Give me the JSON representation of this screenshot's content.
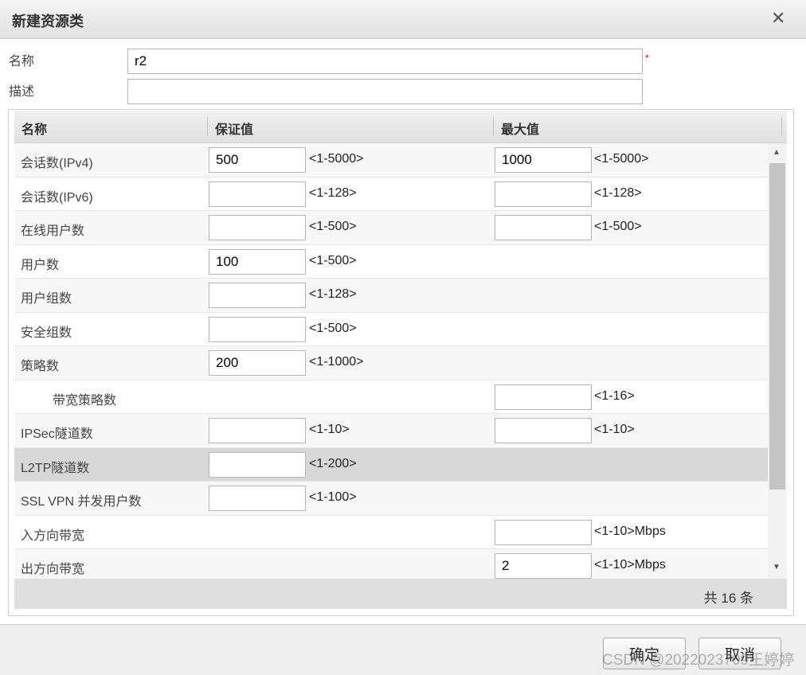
{
  "dialog": {
    "title": "新建资源类"
  },
  "form": {
    "name_label": "名称",
    "name_value": "r2",
    "required_mark": "*",
    "desc_label": "描述",
    "desc_value": ""
  },
  "grid": {
    "columns": [
      "名称",
      "保证值",
      "最大值"
    ],
    "rows": [
      {
        "name": "会话数(IPv4)",
        "guarantee": "500",
        "guarantee_hint": "<1-5000>",
        "max": "1000",
        "max_hint": "<1-5000>"
      },
      {
        "name": "会话数(IPv6)",
        "guarantee": "",
        "guarantee_hint": "<1-128>",
        "max": "",
        "max_hint": "<1-128>"
      },
      {
        "name": "在线用户数",
        "guarantee": "",
        "guarantee_hint": "<1-500>",
        "max": "",
        "max_hint": "<1-500>"
      },
      {
        "name": "用户数",
        "guarantee": "100",
        "guarantee_hint": "<1-500>"
      },
      {
        "name": "用户组数",
        "guarantee": "",
        "guarantee_hint": "<1-128>"
      },
      {
        "name": "安全组数",
        "guarantee": "",
        "guarantee_hint": "<1-500>"
      },
      {
        "name": "策略数",
        "guarantee": "200",
        "guarantee_hint": "<1-1000>"
      },
      {
        "name": "带宽策略数",
        "indent": true,
        "max": "",
        "max_hint": "<1-16>"
      },
      {
        "name": "IPSec隧道数",
        "guarantee": "",
        "guarantee_hint": "<1-10>",
        "max": "",
        "max_hint": "<1-10>"
      },
      {
        "name": "L2TP隧道数",
        "selected": true,
        "guarantee": "",
        "guarantee_hint": "<1-200>"
      },
      {
        "name": "SSL VPN 并发用户数",
        "guarantee": "",
        "guarantee_hint": "<1-100>"
      },
      {
        "name": "入方向带宽",
        "max": "",
        "max_hint": "<1-10>Mbps"
      },
      {
        "name": "出方向带宽",
        "max": "2",
        "max_hint": "<1-10>Mbps"
      },
      {
        "name": "",
        "max": "",
        "max_hint": ""
      }
    ],
    "total_text": "共 16 条"
  },
  "buttons": {
    "ok": "确定",
    "cancel": "取消"
  },
  "watermark": "CSDN @2022023709王婷婷"
}
